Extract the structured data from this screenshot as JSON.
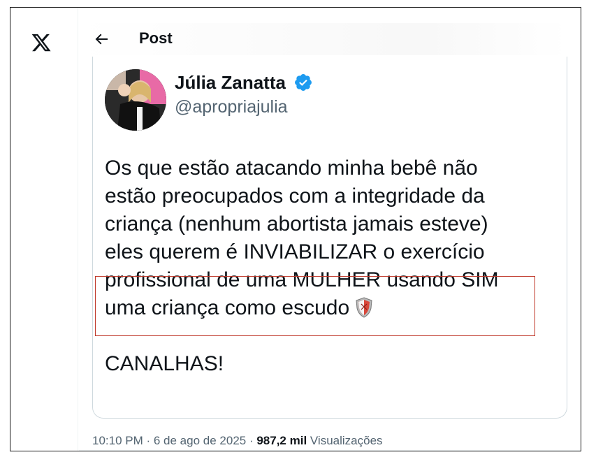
{
  "header": {
    "title": "Post",
    "back_icon": "arrow-left-icon",
    "logo_icon": "x-logo-icon"
  },
  "post": {
    "author_name": "Júlia Zanatta",
    "handle": "@apropriajulia",
    "verified_icon": "verified-badge-icon",
    "lines": [
      "Os que estão atacando minha bebê não",
      "estão preocupados com a integridade da",
      "criança (nenhum abortista jamais esteve)",
      "eles querem  é INVIABILIZAR o exercício",
      "profissional de uma MULHER usando SIM",
      "uma criança como escudo"
    ],
    "closing": "CANALHAS!",
    "emoji_icon": "shield-icon"
  },
  "meta": {
    "time": "10:10 PM",
    "separator1": " · ",
    "date": "6 de ago de 2025",
    "separator2": " · ",
    "views_count": "987,2 mil",
    "views_label": " Visualizações"
  },
  "colors": {
    "text_primary": "#0f1419",
    "text_secondary": "#536471",
    "verified_blue": "#1d9bf0",
    "highlight_red": "#c0392b",
    "border": "#cfd9de"
  }
}
